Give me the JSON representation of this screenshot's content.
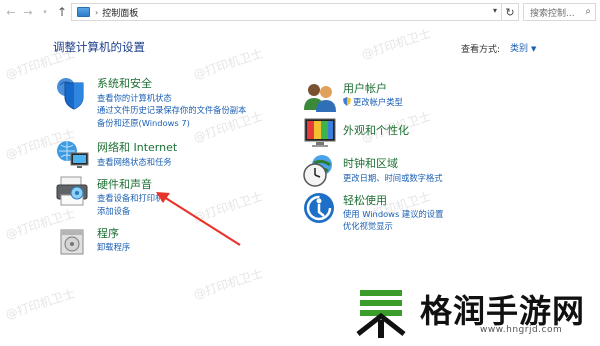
{
  "address_bar": {
    "breadcrumb_sep": "›",
    "breadcrumb": "控制面板",
    "search_placeholder": "搜索控制..."
  },
  "header": {
    "title": "调整计算机的设置",
    "view_label": "查看方式:",
    "view_value": "类别"
  },
  "left_categories": [
    {
      "title": "系统和安全",
      "links": [
        "查看你的计算机状态",
        "通过文件历史记录保存你的文件备份副本",
        "备份和还原(Windows 7)"
      ]
    },
    {
      "title": "网络和 Internet",
      "links": [
        "查看网络状态和任务"
      ]
    },
    {
      "title": "硬件和声音",
      "links": [
        "查看设备和打印机",
        "添加设备"
      ]
    },
    {
      "title": "程序",
      "links": [
        "卸载程序"
      ]
    }
  ],
  "right_categories": [
    {
      "title": "用户帐户",
      "links": [
        "更改帐户类型"
      ]
    },
    {
      "title": "外观和个性化",
      "links": []
    },
    {
      "title": "时钟和区域",
      "links": [
        "更改日期、时间或数字格式"
      ]
    },
    {
      "title": "轻松使用",
      "links": [
        "使用 Windows 建议的设置",
        "优化视觉显示"
      ]
    }
  ],
  "watermark": "@打印机卫士",
  "logo": {
    "name": "格润手游网",
    "url": "www.hngrjd.com"
  },
  "colors": {
    "title_blue": "#1a3e8c",
    "category_green": "#1c6f33",
    "link_blue": "#1a5fb4",
    "arrow_red": "#e8332a"
  }
}
